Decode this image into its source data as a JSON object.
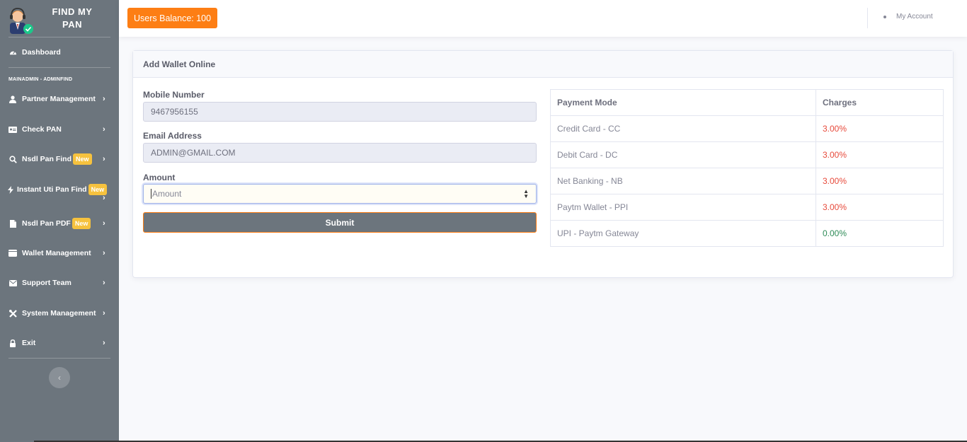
{
  "brand": {
    "name_line1": "FIND MY",
    "name_line2": "PAN",
    "logo_icon": "support-agent-icon"
  },
  "sidebar": {
    "dashboard": {
      "label": "Dashboard",
      "icon": "tachometer-icon"
    },
    "section_heading": "MAINADMIN - ADMINFIND",
    "items": [
      {
        "label": "Partner Management",
        "icon": "user-icon",
        "badge": ""
      },
      {
        "label": "Check PAN",
        "icon": "id-card-icon",
        "badge": ""
      },
      {
        "label": "Nsdl Pan Find",
        "icon": "search-icon",
        "badge": "New"
      },
      {
        "label": "Instant Uti Pan Find",
        "icon": "bolt-icon",
        "badge": "New"
      },
      {
        "label": "Nsdl Pan PDF",
        "icon": "file-icon",
        "badge": "New"
      },
      {
        "label": "Wallet Management",
        "icon": "wallet-icon",
        "badge": ""
      },
      {
        "label": "Support Team",
        "icon": "envelope-icon",
        "badge": ""
      },
      {
        "label": "System Management",
        "icon": "tools-icon",
        "badge": ""
      },
      {
        "label": "Exit",
        "icon": "lock-icon",
        "badge": ""
      }
    ],
    "toggle_icon": "chevron-left-icon"
  },
  "topbar": {
    "balance_label": "Users Balance: 100",
    "account_label": "My Account"
  },
  "card": {
    "title": "Add Wallet Online",
    "form": {
      "mobile_label": "Mobile Number",
      "mobile_value": "9467956155",
      "email_label": "Email Address",
      "email_value": "ADMIN@GMAIL.COM",
      "amount_label": "Amount",
      "amount_placeholder": "Amount",
      "submit_label": "Submit"
    },
    "table": {
      "headers": [
        "Payment Mode",
        "Charges"
      ],
      "rows": [
        {
          "mode": "Credit Card - CC",
          "charge": "3.00%"
        },
        {
          "mode": "Debit Card - DC",
          "charge": "3.00%"
        },
        {
          "mode": "Net Banking - NB",
          "charge": "3.00%"
        },
        {
          "mode": "Paytm Wallet - PPI",
          "charge": "3.00%"
        },
        {
          "mode": "UPI - Paytm Gateway",
          "charge": "0.00%"
        }
      ]
    }
  },
  "colors": {
    "sidebar_bg": "#6c757d",
    "balance_btn": "#fd7e14",
    "badge": "#f6c23e",
    "charge_red": "#e74a3b",
    "charge_green": "#2e8b57"
  }
}
